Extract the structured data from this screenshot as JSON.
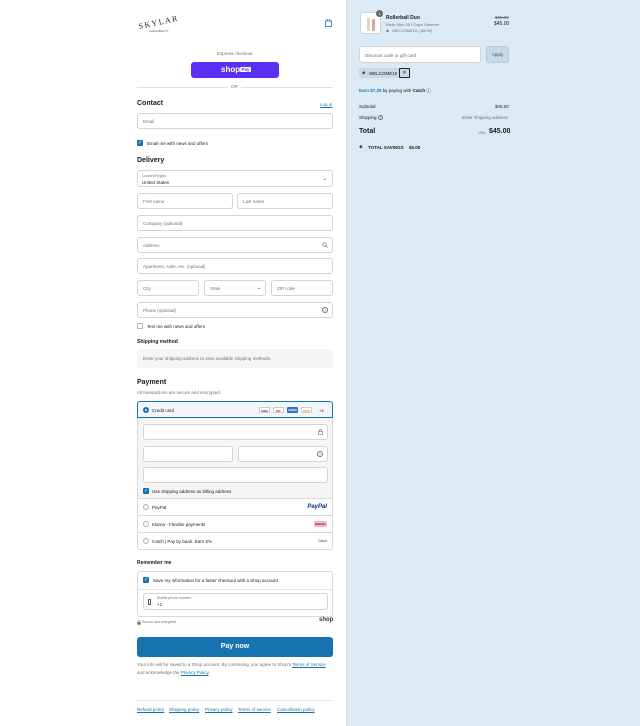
{
  "brand": {
    "logo_text": "SKYLAR",
    "logo_sub": "CLEAN BEAUTY"
  },
  "express": {
    "label": "Express checkout",
    "shop_pay_word": "shop",
    "shop_pay_badge": "Pay",
    "or": "OR"
  },
  "contact": {
    "title": "Contact",
    "login_link": "Log in",
    "email_placeholder": "Email",
    "news_label": "Email me with news and offers"
  },
  "delivery": {
    "title": "Delivery",
    "country_label": "Country/Region",
    "country_value": "United States",
    "first_name": "First name",
    "last_name": "Last name",
    "company": "Company (optional)",
    "address": "Address",
    "apartment": "Apartment, suite, etc. (optional)",
    "city": "City",
    "state": "State",
    "zip": "ZIP code",
    "phone": "Phone (optional)",
    "text_label": "Text me with news and offers"
  },
  "shipping_method": {
    "title": "Shipping method",
    "message": "Enter your shipping address to view available shipping methods."
  },
  "payment": {
    "title": "Payment",
    "subtitle": "All transactions are secure and encrypted.",
    "credit_card": "Credit card",
    "more_cards": "+4",
    "card_icons": [
      "VISA",
      "MC",
      "AMEX",
      "DISC"
    ],
    "billing_label": "Use shipping address as billing address",
    "paypal_label": "PayPal",
    "paypal_logo": "PayPal",
    "klarna_label": "Klarna - Flexible payments",
    "klarna_logo": "Klarna.",
    "catch_label": "Catch | Pay by bank. Earn 5%",
    "catch_logo": "Catch"
  },
  "remember": {
    "title": "Remember me",
    "save_label": "Save my information for a faster checkout with a Shop account",
    "phone_label": "Mobile phone number",
    "phone_value": "+1",
    "secure": "Secure and encrypted",
    "shop_logo": "shop"
  },
  "pay_button": "Pay now",
  "terms": {
    "prefix": "Your info will be saved to a Shop account. By continuing, you agree to Shop's",
    "tos": "Terms of Service",
    "middle": "and acknowledge the",
    "privacy": "Privacy Policy",
    "suffix": "."
  },
  "footer": [
    "Refund policy",
    "Shipping policy",
    "Privacy policy",
    "Terms of service",
    "Cancellation policy"
  ],
  "summary": {
    "item_name": "Rollerball Duo",
    "item_variant": "Nude Skin 05 / Capri Summer",
    "item_discount": "WELCOME10 (-$5.00)",
    "item_qty": "1",
    "item_old_price": "$50.00",
    "item_price": "$45.00",
    "discount_placeholder": "Discount code or gift card",
    "apply": "Apply",
    "code_tag": "WELCOME10",
    "catch_earn": "Earn $7.29",
    "catch_by": "by paying with",
    "catch_brand": "Catch",
    "subtotal_label": "Subtotal",
    "subtotal_value": "$45.00",
    "shipping_label": "Shipping",
    "shipping_value": "Enter shipping address",
    "total_label": "Total",
    "currency": "USD",
    "total_value": "$45.00",
    "savings_label": "TOTAL SAVINGS",
    "savings_value": "$5.00"
  },
  "colors": {
    "accent": "#1773b0",
    "shop_pay": "#5a31f4",
    "pay_button": "#1773b0",
    "right_bg": "#dbeaf4"
  }
}
